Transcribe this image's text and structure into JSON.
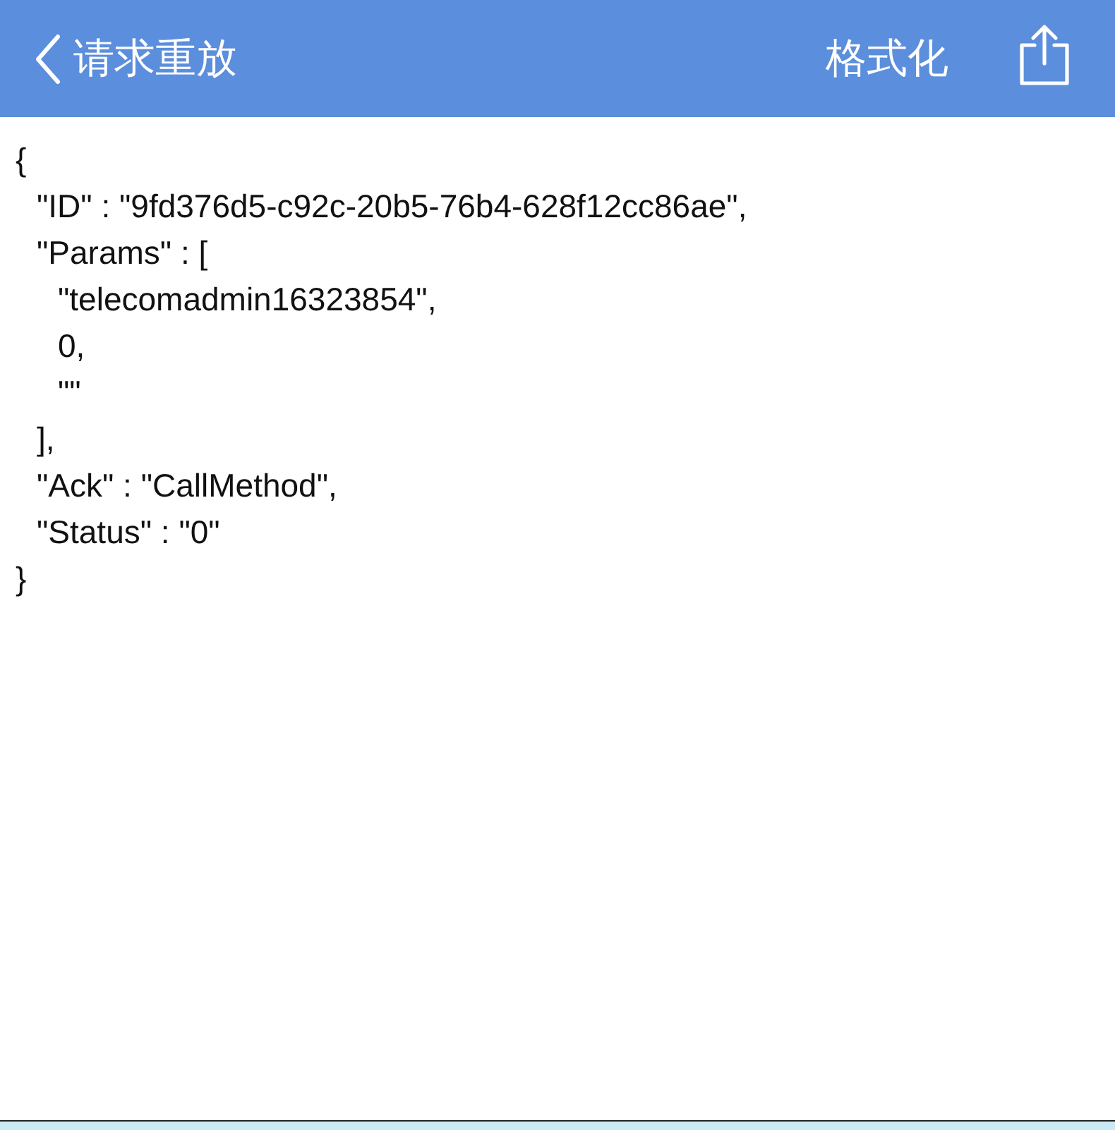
{
  "nav_bar": {
    "back_label": "请求重放",
    "format_button": "格式化"
  },
  "code_lines": [
    {
      "text": "{",
      "children": [
        {
          "text": "\"ID\" : \"9fd376d5-c92c-20b5-76b4-628f12cc86ae\","
        },
        {
          "text": "\"Params\" : [",
          "children": [
            {
              "text": "\"telecomadmin16323854\","
            },
            {
              "text": "0,"
            },
            {
              "text": "\"\""
            }
          ]
        },
        {
          "text": "],"
        },
        {
          "text": "\"Ack\" : \"CallMethod\","
        },
        {
          "text": "\"Status\" : \"0\""
        }
      ]
    },
    {
      "text": "}"
    }
  ]
}
